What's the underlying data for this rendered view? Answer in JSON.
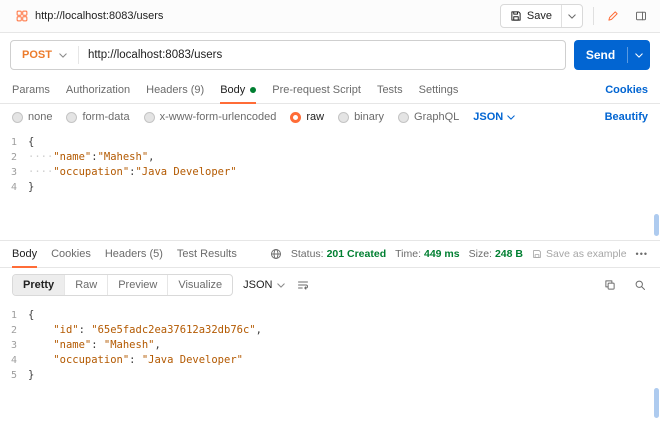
{
  "colors": {
    "accent_orange": "#FF6C37",
    "link_blue": "#0265D2",
    "status_green": "#007F31",
    "post_method_orange": "#EC7B2B",
    "string_token_orange": "#B35900"
  },
  "topbar": {
    "request_title": "http://localhost:8083/users",
    "save_label": "Save"
  },
  "request_bar": {
    "method": "POST",
    "url": "http://localhost:8083/users",
    "send_label": "Send"
  },
  "request_tabs": {
    "items": [
      {
        "label": "Params"
      },
      {
        "label": "Authorization"
      },
      {
        "label": "Headers (9)"
      },
      {
        "label": "Body",
        "active": true,
        "has_dot": true
      },
      {
        "label": "Pre-request Script"
      },
      {
        "label": "Tests"
      },
      {
        "label": "Settings"
      }
    ],
    "cookies_label": "Cookies"
  },
  "body_type_bar": {
    "options": [
      {
        "label": "none",
        "selected": false
      },
      {
        "label": "form-data",
        "selected": false
      },
      {
        "label": "x-www-form-urlencoded",
        "selected": false
      },
      {
        "label": "raw",
        "selected": true
      },
      {
        "label": "binary",
        "selected": false
      },
      {
        "label": "GraphQL",
        "selected": false
      }
    ],
    "language": "JSON",
    "beautify_label": "Beautify"
  },
  "request_editor": {
    "lines": [
      {
        "num": "1",
        "tokens": [
          {
            "t": "p",
            "v": "{"
          }
        ]
      },
      {
        "num": "2",
        "tokens": [
          {
            "t": "ws",
            "v": "····"
          },
          {
            "t": "s",
            "v": "\"name\""
          },
          {
            "t": "p",
            "v": ":"
          },
          {
            "t": "s",
            "v": "\"Mahesh\""
          },
          {
            "t": "p",
            "v": ","
          }
        ]
      },
      {
        "num": "3",
        "tokens": [
          {
            "t": "ws",
            "v": "····"
          },
          {
            "t": "s",
            "v": "\"occupation\""
          },
          {
            "t": "p",
            "v": ":"
          },
          {
            "t": "s",
            "v": "\"Java Developer\""
          }
        ]
      },
      {
        "num": "4",
        "tokens": [
          {
            "t": "p",
            "v": "}"
          }
        ]
      }
    ]
  },
  "response": {
    "tabs": [
      {
        "label": "Body",
        "active": true
      },
      {
        "label": "Cookies"
      },
      {
        "label": "Headers (5)"
      },
      {
        "label": "Test Results"
      }
    ],
    "status_label": "Status:",
    "status_value": "201 Created",
    "time_label": "Time:",
    "time_value": "449 ms",
    "size_label": "Size:",
    "size_value": "248 B",
    "save_example_label": "Save as example",
    "more_icon": "•••",
    "view_tabs": [
      {
        "label": "Pretty",
        "active": true
      },
      {
        "label": "Raw"
      },
      {
        "label": "Preview"
      },
      {
        "label": "Visualize"
      }
    ],
    "language": "JSON",
    "editor": {
      "lines": [
        {
          "num": "1",
          "tokens": [
            {
              "t": "p",
              "v": "{"
            }
          ]
        },
        {
          "num": "2",
          "tokens": [
            {
              "t": "sp",
              "v": "    "
            },
            {
              "t": "s",
              "v": "\"id\""
            },
            {
              "t": "p",
              "v": ": "
            },
            {
              "t": "s",
              "v": "\"65e5fadc2ea37612a32db76c\""
            },
            {
              "t": "p",
              "v": ","
            }
          ]
        },
        {
          "num": "3",
          "tokens": [
            {
              "t": "sp",
              "v": "    "
            },
            {
              "t": "s",
              "v": "\"name\""
            },
            {
              "t": "p",
              "v": ": "
            },
            {
              "t": "s",
              "v": "\"Mahesh\""
            },
            {
              "t": "p",
              "v": ","
            }
          ]
        },
        {
          "num": "4",
          "tokens": [
            {
              "t": "sp",
              "v": "    "
            },
            {
              "t": "s",
              "v": "\"occupation\""
            },
            {
              "t": "p",
              "v": ": "
            },
            {
              "t": "s",
              "v": "\"Java Developer\""
            }
          ]
        },
        {
          "num": "5",
          "tokens": [
            {
              "t": "p",
              "v": "}"
            }
          ]
        }
      ]
    }
  }
}
